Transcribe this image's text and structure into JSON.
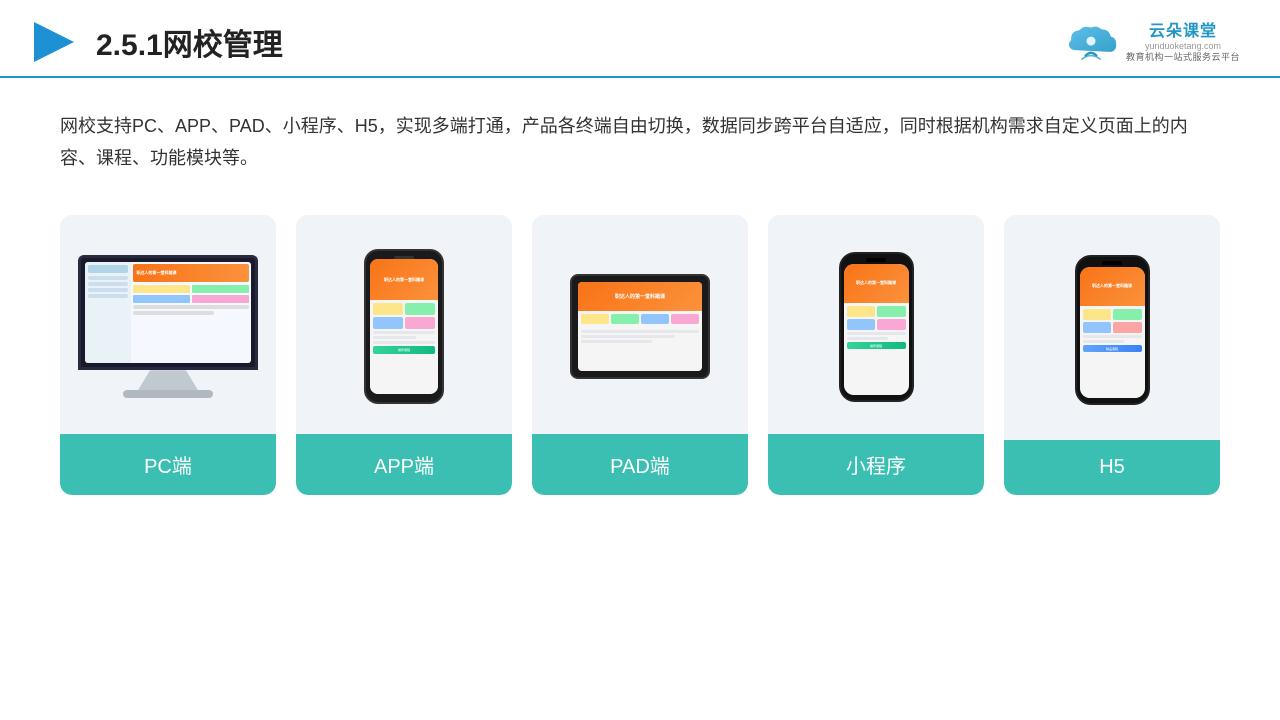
{
  "header": {
    "section_number": "2.5.1",
    "title": "网校管理",
    "logo_name": "云朵课堂",
    "logo_domain": "yunduoketang.com",
    "logo_tagline_line1": "教育机构一站",
    "logo_tagline_line2": "式服务云平台"
  },
  "description": {
    "text": "网校支持PC、APP、PAD、小程序、H5，实现多端打通，产品各终端自由切换，数据同步跨平台自适应，同时根据机构需求自定义页面上的内容、课程、功能模块等。"
  },
  "cards": [
    {
      "id": "pc",
      "label": "PC端",
      "device_type": "monitor"
    },
    {
      "id": "app",
      "label": "APP端",
      "device_type": "phone"
    },
    {
      "id": "pad",
      "label": "PAD端",
      "device_type": "tablet"
    },
    {
      "id": "miniapp",
      "label": "小程序",
      "device_type": "phone_notch"
    },
    {
      "id": "h5",
      "label": "H5",
      "device_type": "phone_notch"
    }
  ]
}
